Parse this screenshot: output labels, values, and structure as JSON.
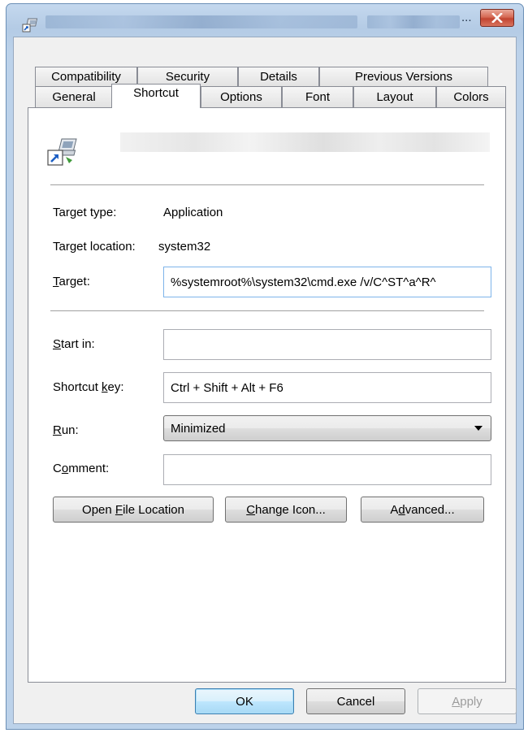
{
  "window": {
    "title_suffix": "...",
    "close_label": "Close"
  },
  "tabs_row1": [
    {
      "label": "Compatibility"
    },
    {
      "label": "Security"
    },
    {
      "label": "Details"
    },
    {
      "label": "Previous Versions"
    }
  ],
  "tabs_row2": [
    {
      "label": "General"
    },
    {
      "label": "Shortcut",
      "active": true
    },
    {
      "label": "Options"
    },
    {
      "label": "Font"
    },
    {
      "label": "Layout"
    },
    {
      "label": "Colors"
    }
  ],
  "shortcut": {
    "target_type_label": "Target type:",
    "target_type_value": "Application",
    "target_location_label": "Target location:",
    "target_location_value": "system32",
    "target_label_pre": "",
    "target_label_u": "T",
    "target_label_post": "arget:",
    "target_value": "%systemroot%\\system32\\cmd.exe /v/C^ST^a^R^",
    "start_in_label_u": "S",
    "start_in_label_post": "tart in:",
    "start_in_value": "",
    "shortcut_key_label_pre": "Shortcut ",
    "shortcut_key_label_u": "k",
    "shortcut_key_label_post": "ey:",
    "shortcut_key_value": "Ctrl + Shift + Alt + F6",
    "run_label_u": "R",
    "run_label_post": "un:",
    "run_value": "Minimized",
    "comment_label_pre": "C",
    "comment_label_u": "o",
    "comment_label_post": "mment:",
    "comment_value": ""
  },
  "buttons": {
    "open_file_pre": "Open ",
    "open_file_u": "F",
    "open_file_post": "ile Location",
    "change_icon_u": "C",
    "change_icon_post": "hange Icon...",
    "advanced_pre": "A",
    "advanced_u": "d",
    "advanced_post": "vanced...",
    "ok": "OK",
    "cancel": "Cancel",
    "apply_u": "A",
    "apply_post": "pply"
  },
  "icons": {
    "title": "shortcut-app-icon",
    "shortcut": "shortcut-app-icon",
    "close": "close-icon",
    "dropdown": "chevron-down-icon"
  },
  "colors": {
    "close_button": "#c24430",
    "focus_border": "#7eb4ea",
    "frame": "#b4cbe5"
  }
}
